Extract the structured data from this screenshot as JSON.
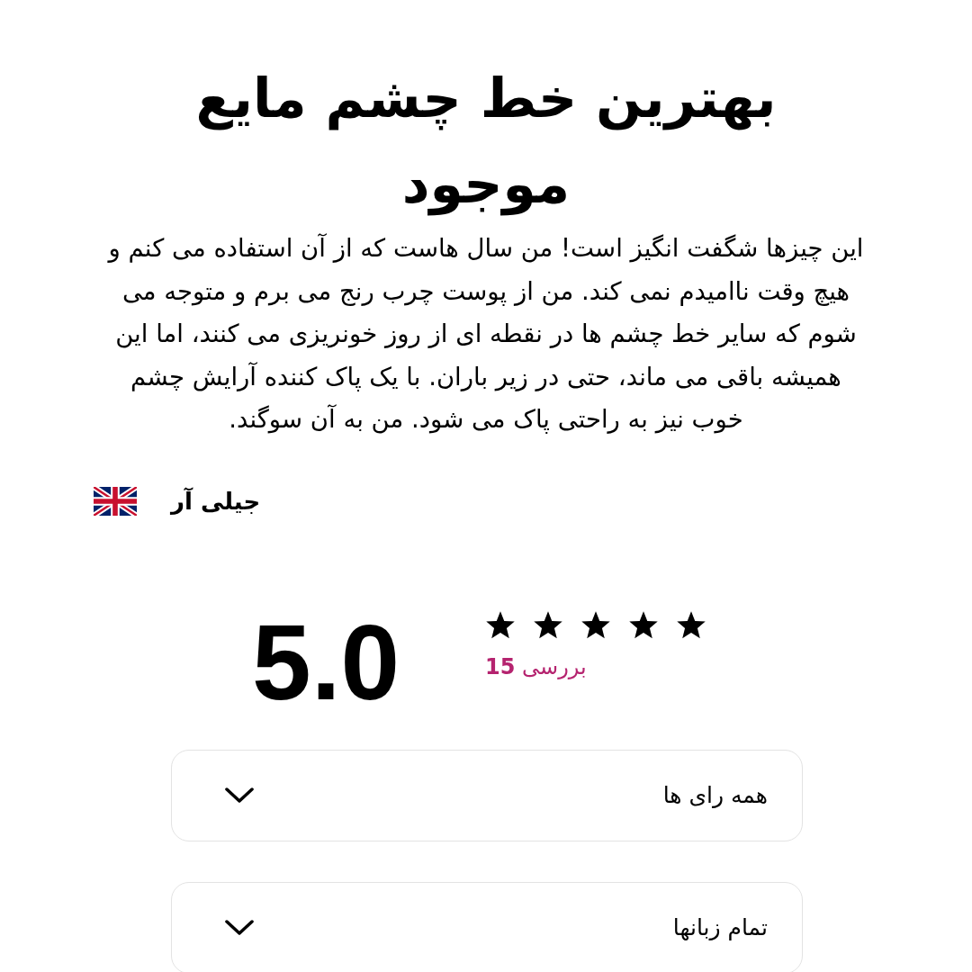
{
  "review": {
    "title": "بهترین خط چشم مایع موجود",
    "body": "این چیزها شگفت انگیز است! من سال هاست که از آن استفاده می کنم و هیچ وقت ناامیدم نمی کند. من از پوست چرب رنج می برم و متوجه می شوم که سایر خط چشم ها در نقطه ای از روز خونریزی می کنند، اما این همیشه باقی می ماند، حتی در زیر باران. با یک پاک کننده آرایش چشم خوب نیز به راحتی پاک می شود. من به آن سوگند.",
    "author": "جیلی آر"
  },
  "summary": {
    "rating": "5.0",
    "stars": 5,
    "count_label": "بررسی **15**"
  },
  "filters": [
    {
      "label": "همه رای ها"
    },
    {
      "label": "تمام زبانها"
    }
  ]
}
